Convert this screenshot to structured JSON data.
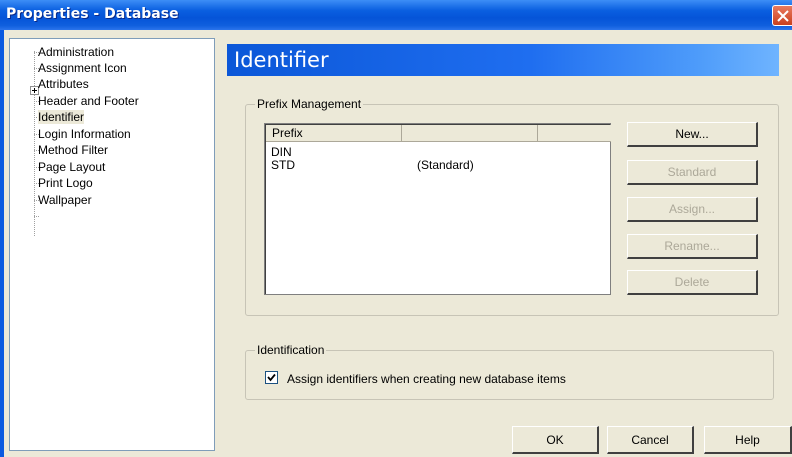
{
  "window": {
    "title": "Properties - Database"
  },
  "tree": {
    "items": [
      {
        "label": "Administration",
        "expandable": false
      },
      {
        "label": "Assignment Icon",
        "expandable": false
      },
      {
        "label": "Attributes",
        "expandable": true
      },
      {
        "label": "Header and Footer",
        "expandable": false
      },
      {
        "label": "Identifier",
        "expandable": false,
        "selected": true
      },
      {
        "label": "Login Information",
        "expandable": false
      },
      {
        "label": "Method Filter",
        "expandable": false
      },
      {
        "label": "Page Layout",
        "expandable": false
      },
      {
        "label": "Print Logo",
        "expandable": false
      },
      {
        "label": "Wallpaper",
        "expandable": false
      }
    ]
  },
  "panel": {
    "title": "Identifier"
  },
  "prefix_management": {
    "label": "Prefix Management",
    "columns": [
      "Prefix",
      "",
      ""
    ],
    "rows": [
      {
        "prefix": "DIN",
        "note": ""
      },
      {
        "prefix": "STD",
        "note": "(Standard)"
      }
    ],
    "buttons": {
      "new": "New...",
      "standard": "Standard",
      "assign": "Assign...",
      "rename": "Rename...",
      "delete": "Delete"
    }
  },
  "identification": {
    "label": "Identification",
    "checkbox_label": "Assign identifiers when creating new database items",
    "checked": true
  },
  "footer": {
    "ok": "OK",
    "cancel": "Cancel",
    "help": "Help"
  },
  "colors": {
    "title_bar": "#0a5fe0",
    "banner": "#1f6ef0",
    "face": "#ECE9D8",
    "disabled_text": "#aca899"
  },
  "icons": {
    "close": "close-icon",
    "checkmark": "checkmark-icon",
    "expand": "plus-expander-icon"
  }
}
